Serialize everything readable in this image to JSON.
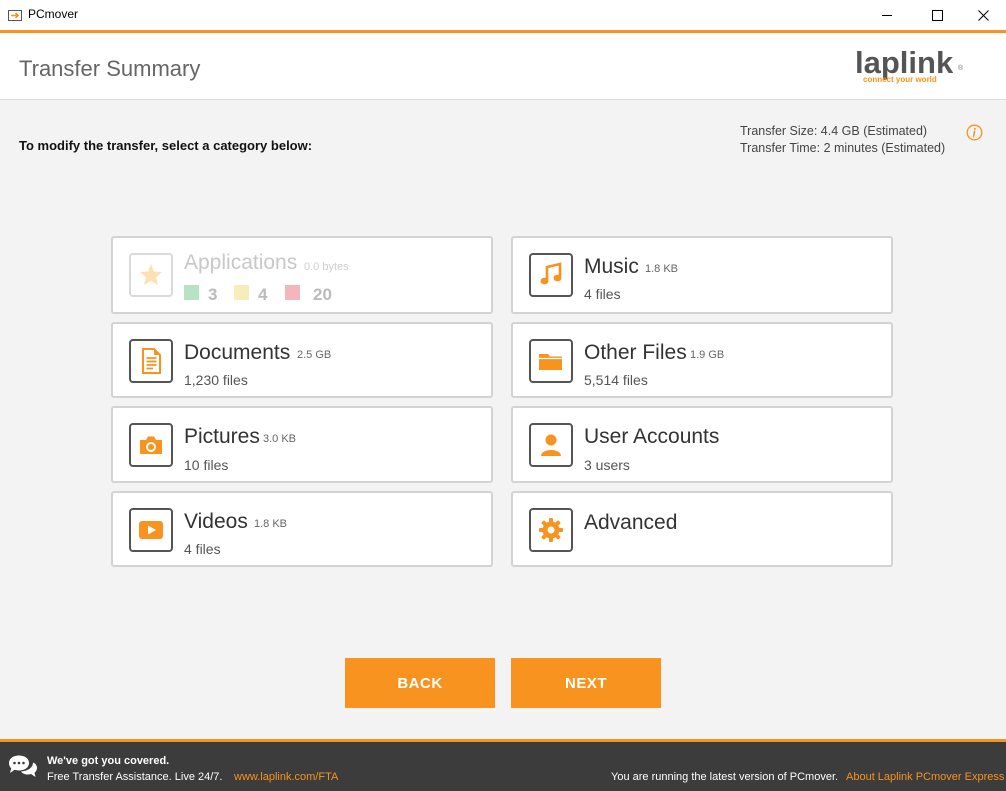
{
  "window": {
    "title": "PCmover"
  },
  "header": {
    "title": "Transfer Summary",
    "logo_text": "laplink",
    "logo_tagline": "connect your world",
    "logo_mark": "®"
  },
  "instruction": "To modify the transfer, select a category below:",
  "transfer": {
    "size_text": "Transfer Size: 4.4 GB (Estimated)",
    "time_text": "Transfer Time: 2 minutes (Estimated)"
  },
  "categories": [
    {
      "name": "Applications",
      "size": "0.0 bytes",
      "state": "disabled",
      "icon": "star-icon",
      "counts": [
        {
          "value": "3",
          "color": "#b7e2c4"
        },
        {
          "value": "4",
          "color": "#f5eeba"
        },
        {
          "value": "20",
          "color": "#f3b6bd"
        }
      ]
    },
    {
      "name": "Music",
      "size": "1.8 KB",
      "sub": "4 files",
      "icon": "music-note-icon"
    },
    {
      "name": "Documents",
      "size": "2.5 GB",
      "sub": "1,230 files",
      "icon": "document-icon"
    },
    {
      "name": "Other Files",
      "size": "1.9 GB",
      "sub": "5,514 files",
      "icon": "folder-icon"
    },
    {
      "name": "Pictures",
      "size": "3.0 KB",
      "sub": "10 files",
      "icon": "camera-icon"
    },
    {
      "name": "User Accounts",
      "size": "",
      "sub": "3 users",
      "icon": "user-icon"
    },
    {
      "name": "Videos",
      "size": "1.8 KB",
      "sub": "4 files",
      "icon": "play-icon"
    },
    {
      "name": "Advanced",
      "size": "",
      "sub": "",
      "icon": "gear-icon"
    }
  ],
  "buttons": {
    "back": "BACK",
    "next": "NEXT"
  },
  "footer": {
    "headline": "We've got you covered.",
    "subline": "Free Transfer Assistance. Live 24/7.",
    "link": "www.laplink.com/FTA",
    "status": "You are running the latest version of PCmover.",
    "about": "About Laplink PCmover Express"
  },
  "colors": {
    "accent": "#f7931e",
    "footer_bg": "#3c3c3c",
    "card_border": "#d3d3d3"
  }
}
